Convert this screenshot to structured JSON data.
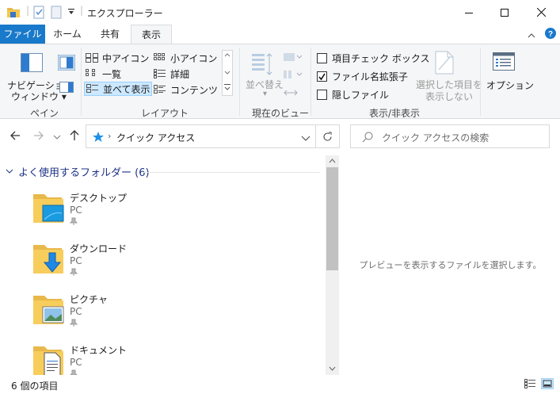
{
  "window": {
    "title": "エクスプローラー",
    "minimize_icon": "minimize-icon",
    "maximize_icon": "maximize-icon",
    "close_icon": "close-icon"
  },
  "ribbon_tabs": [
    {
      "label": "ファイル"
    },
    {
      "label": "ホーム"
    },
    {
      "label": "共有"
    },
    {
      "label": "表示",
      "active": true
    }
  ],
  "ribbon": {
    "pane_group": {
      "navigation_pane_line1": "ナビゲーション",
      "navigation_pane_line2": "ウィンドウ ▾",
      "label": "ペイン"
    },
    "layout_group": {
      "items": [
        {
          "label": "中アイコン"
        },
        {
          "label": "小アイコン"
        },
        {
          "label": "一覧"
        },
        {
          "label": "詳細"
        },
        {
          "label": "並べて表示",
          "selected": true
        },
        {
          "label": "コンテンツ"
        }
      ],
      "label": "レイアウト"
    },
    "current_view_group": {
      "sort_label": "並べ替え",
      "label": "現在のビュー"
    },
    "show_hide_group": {
      "item_checkboxes": {
        "label": "項目チェック ボックス",
        "checked": false
      },
      "file_extensions": {
        "label": "ファイル名拡張子",
        "checked": true
      },
      "hidden_items": {
        "label": "隠しファイル",
        "checked": false
      },
      "hide_selected_line1": "選択した項目を",
      "hide_selected_line2": "表示しない",
      "label": "表示/非表示"
    },
    "options_label": "オプション"
  },
  "address": {
    "location": "クイック アクセス",
    "search_placeholder": "クイック アクセスの検索"
  },
  "content": {
    "group_header": "よく使用するフォルダー (6)",
    "items": [
      {
        "name": "デスクトップ",
        "location": "PC",
        "icon": "desktop-folder-icon"
      },
      {
        "name": "ダウンロード",
        "location": "PC",
        "icon": "downloads-folder-icon"
      },
      {
        "name": "ピクチャ",
        "location": "PC",
        "icon": "pictures-folder-icon"
      },
      {
        "name": "ドキュメント",
        "location": "PC",
        "icon": "documents-folder-icon"
      }
    ]
  },
  "preview": {
    "message": "プレビューを表示するファイルを選択します。"
  },
  "status": {
    "item_count": "6 個の項目"
  },
  "colors": {
    "accent": "#1979ca",
    "ribbon_bg": "#f5f6f7",
    "selection": "#cce8ff",
    "group_header": "#1e3287"
  }
}
